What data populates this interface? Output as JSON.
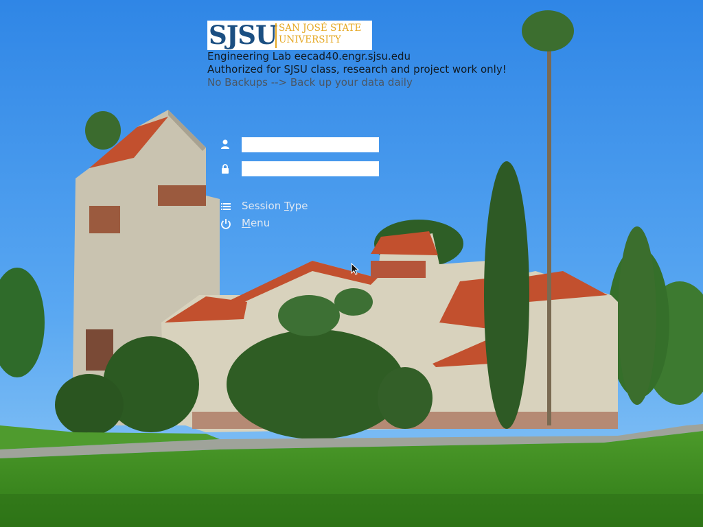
{
  "logo": {
    "brand": "SJSU",
    "line1": "SAN JOSÉ STATE",
    "line2": "UNIVERSITY"
  },
  "info": {
    "host_line": "Engineering Lab eecad40.engr.sjsu.edu",
    "auth_line": "Authorized for SJSU class, research and project work only!",
    "backup_line": "No Backups --> Back up your data daily"
  },
  "login": {
    "username_value": "",
    "password_value": ""
  },
  "session": {
    "label_before": "Session ",
    "label_underlined": "T",
    "label_after": "ype"
  },
  "menu": {
    "label_underlined": "M",
    "label_after": "enu"
  },
  "icons": {
    "username": "user-icon",
    "password": "lock-icon",
    "session": "list-icon",
    "menu": "power-icon"
  },
  "colors": {
    "sjsu_blue": "#1b4f82",
    "sjsu_gold": "#e5a823"
  }
}
